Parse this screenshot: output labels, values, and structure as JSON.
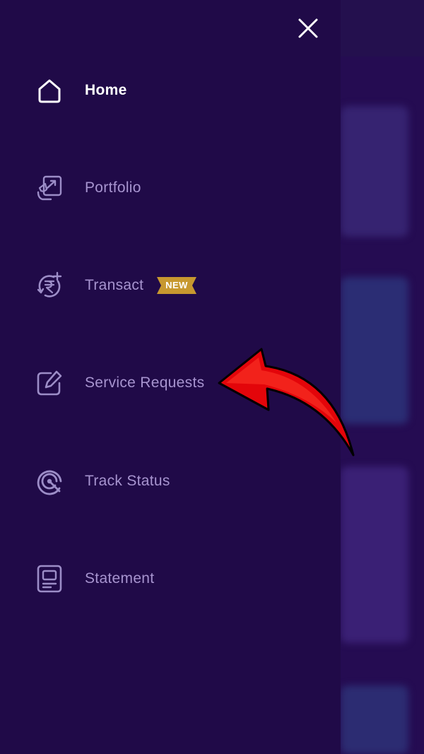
{
  "colors": {
    "drawer_bg": "#200a48",
    "label_inactive": "#a794cf",
    "label_active": "#ffffff",
    "badge_bg": "#c7982f",
    "arrow_fill": "#e3050a"
  },
  "header": {
    "close_icon": "close-icon"
  },
  "menu": {
    "items": [
      {
        "label": "Home",
        "icon": "home-icon",
        "active": true
      },
      {
        "label": "Portfolio",
        "icon": "portfolio-icon",
        "active": false
      },
      {
        "label": "Transact",
        "icon": "rupee-refresh-icon",
        "active": false,
        "badge": "NEW"
      },
      {
        "label": "Service Requests",
        "icon": "edit-icon",
        "active": false
      },
      {
        "label": "Track Status",
        "icon": "track-icon",
        "active": false
      },
      {
        "label": "Statement",
        "icon": "statement-icon",
        "active": false
      }
    ]
  },
  "annotation": {
    "icon": "red-curved-arrow",
    "points_to": "Service Requests"
  }
}
